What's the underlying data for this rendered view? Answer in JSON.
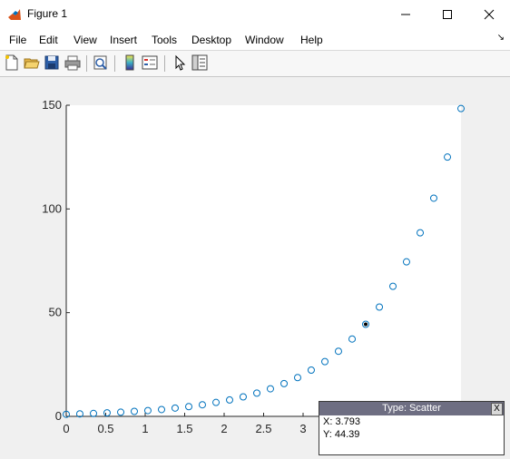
{
  "window": {
    "title": "Figure 1",
    "controls": [
      "minimize",
      "maximize",
      "close"
    ]
  },
  "menubar": {
    "items": [
      "File",
      "Edit",
      "View",
      "Insert",
      "Tools",
      "Desktop",
      "Window",
      "Help"
    ],
    "dock_glyph": "↘"
  },
  "toolbar": {
    "icons": [
      "new-figure-icon",
      "open-file-icon",
      "save-icon",
      "print-icon",
      "print-preview-icon",
      "colorbar-icon",
      "legend-icon",
      "edit-plot-icon",
      "property-inspector-icon"
    ]
  },
  "chart_data": {
    "type": "scatter",
    "title": "",
    "xlabel": "",
    "ylabel": "",
    "xlim": [
      0,
      5
    ],
    "ylim": [
      0,
      150
    ],
    "xticks": [
      "0",
      "0.5",
      "1",
      "1.5",
      "2",
      "2.5",
      "3"
    ],
    "yticks": [
      "0",
      "50",
      "100",
      "150"
    ],
    "grid": false,
    "marker": "o",
    "marker_color": "#0072bd",
    "series": [
      {
        "x": [
          0,
          0.172,
          0.345,
          0.517,
          0.69,
          0.862,
          1.034,
          1.207,
          1.379,
          1.552,
          1.724,
          1.897,
          2.069,
          2.241,
          2.414,
          2.586,
          2.759,
          2.931,
          3.103,
          3.276,
          3.448,
          3.621,
          3.793,
          3.966,
          4.138,
          4.31,
          4.483,
          4.655,
          4.828,
          5
        ],
        "y": [
          1,
          1.2,
          1.4,
          1.7,
          2.0,
          2.4,
          2.8,
          3.3,
          4.0,
          4.7,
          5.6,
          6.7,
          7.9,
          9.4,
          11.2,
          13.3,
          15.8,
          18.7,
          22.3,
          26.4,
          31.4,
          37.3,
          44.39,
          52.7,
          62.7,
          74.5,
          88.5,
          105.2,
          125.0,
          148.4
        ]
      }
    ],
    "highlight_index": 22
  },
  "datatip": {
    "header": "Type: Scatter",
    "close_label": "X",
    "x_text": "X: 3.793",
    "y_text": "Y: 44.39"
  }
}
